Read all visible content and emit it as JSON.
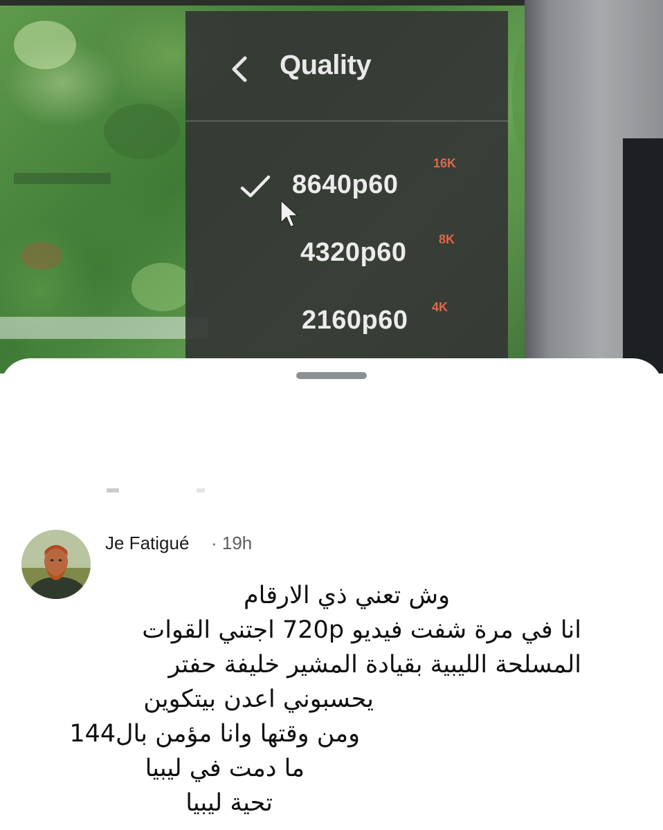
{
  "quality_menu": {
    "title": "Quality",
    "options": [
      {
        "label": "8640p60",
        "badge": "16K",
        "selected": true
      },
      {
        "label": "4320p60",
        "badge": "8K",
        "selected": false
      },
      {
        "label": "2160p60",
        "badge": "4K",
        "selected": false
      }
    ],
    "badge_color": "#e0664a"
  },
  "comment": {
    "author": "Je Fatigué",
    "time": "· 19h",
    "lines": [
      "وش تعني ذي الارقام",
      "انا في مرة شفت فيديو 720p اجتني القوات",
      "المسلحة الليبية بقيادة المشير خليفة حفتر",
      "يحسبوني اعدن بيتكوين",
      "ومن وقتها وانا مؤمن بال144",
      "ما دمت في ليبيا",
      "تحية ليبيا"
    ]
  },
  "icons": {
    "back": "chevron-left-icon",
    "selected": "check-icon",
    "pointer": "mouse-cursor-icon"
  }
}
